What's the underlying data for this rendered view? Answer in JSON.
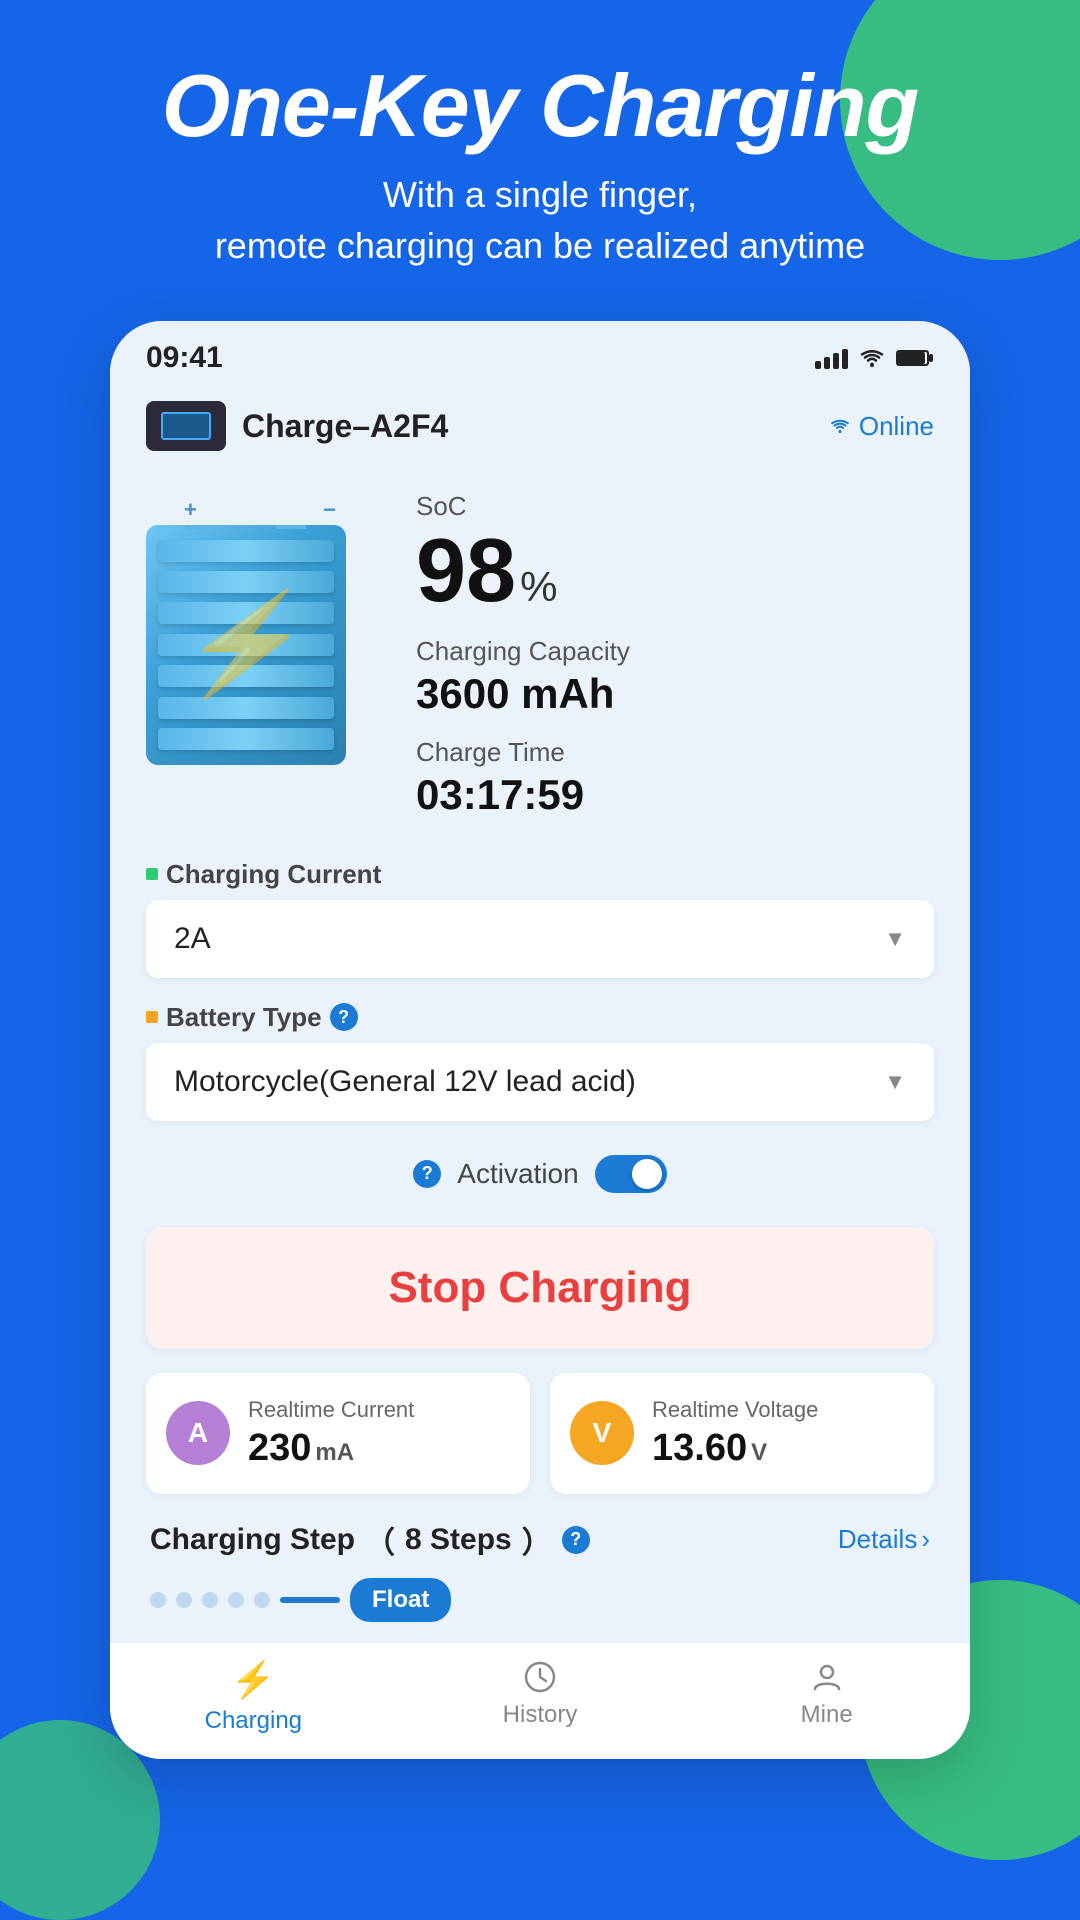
{
  "background": {
    "color": "#1565e8",
    "accent_color": "#3dcc6e"
  },
  "hero": {
    "title": "One-Key Charging",
    "subtitle": "With a single finger,\nremote charging can be realized anytime"
  },
  "status_bar": {
    "time": "09:41"
  },
  "device": {
    "name": "Charge–A2F4",
    "status": "Online"
  },
  "battery": {
    "soc_label": "SoC",
    "soc_value": "98",
    "soc_unit": "%",
    "capacity_label": "Charging Capacity",
    "capacity_value": "3600 mAh",
    "time_label": "Charge Time",
    "time_value": "03:17:59"
  },
  "charging_current": {
    "label": "Charging Current",
    "value": "2A"
  },
  "battery_type": {
    "label": "Battery Type",
    "value": "Motorcycle(General 12V lead acid)"
  },
  "activation": {
    "label": "Activation",
    "enabled": true
  },
  "stop_charging": {
    "label": "Stop Charging"
  },
  "realtime_current": {
    "label": "Realtime Current",
    "value": "230",
    "unit": "mA",
    "icon_letter": "A"
  },
  "realtime_voltage": {
    "label": "Realtime Voltage",
    "value": "13.60",
    "unit": "V",
    "icon_letter": "V"
  },
  "charging_step": {
    "label": "Charging Step",
    "steps": "8 Steps",
    "details_label": "Details",
    "float_label": "Float"
  },
  "bottom_nav": {
    "items": [
      {
        "label": "Charging",
        "active": true
      },
      {
        "label": "History",
        "active": false
      },
      {
        "label": "Mine",
        "active": false
      }
    ]
  }
}
